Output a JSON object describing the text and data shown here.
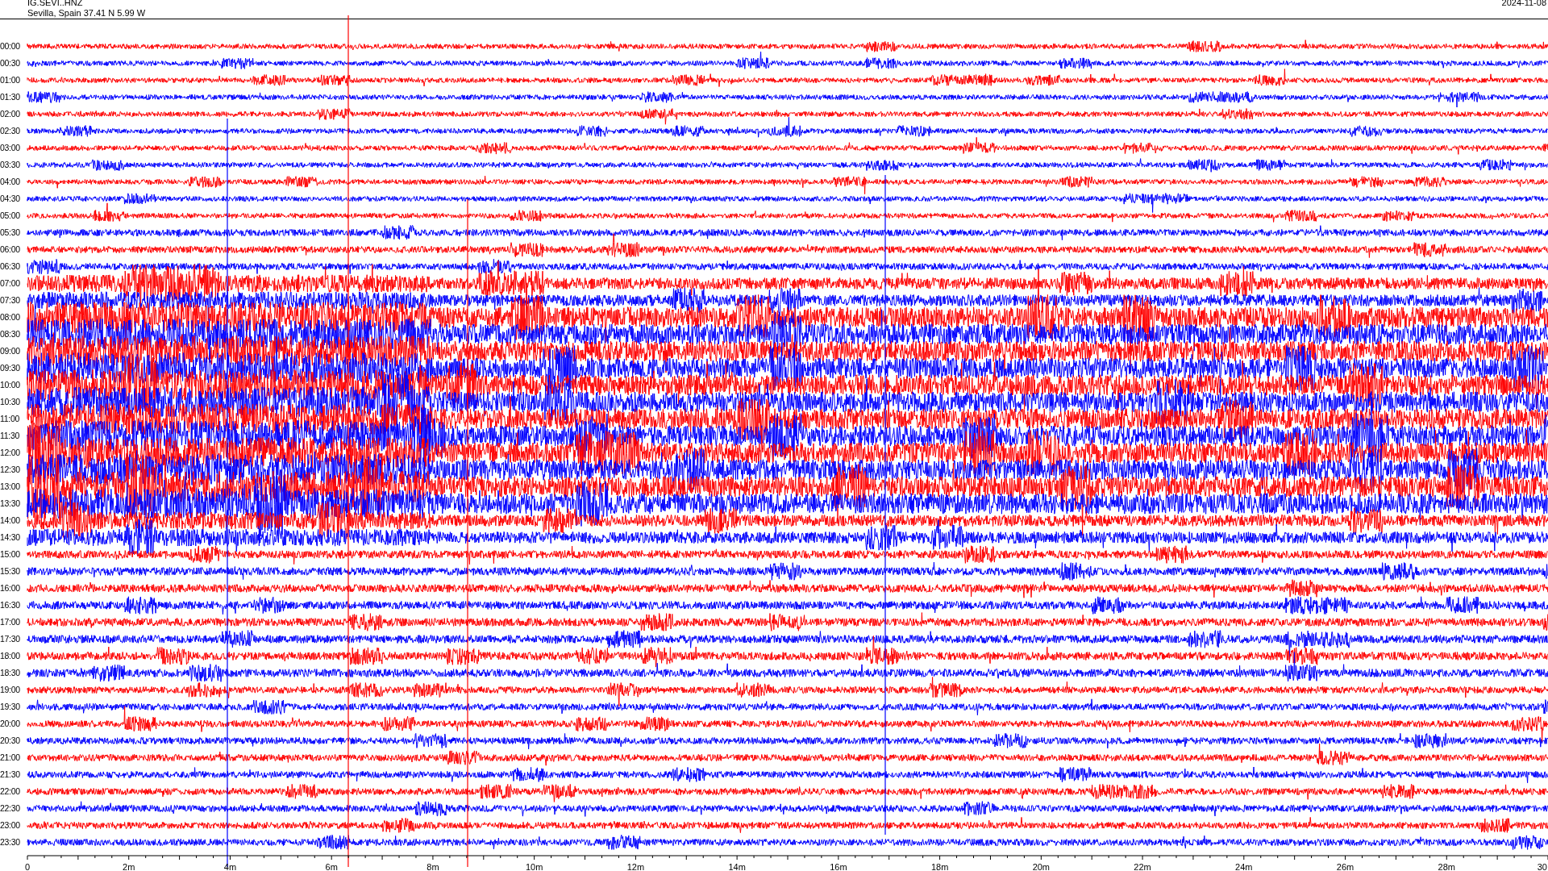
{
  "header": {
    "station": "IG.SEVI..HNZ",
    "location": "Sevilla, Spain  37.41 N 5.99 W",
    "date": "2024-11-08"
  },
  "rows": [
    {
      "label": "00:00",
      "color": "#ff0000"
    },
    {
      "label": "00:30",
      "color": "#0000ff"
    },
    {
      "label": "01:00",
      "color": "#ff0000"
    },
    {
      "label": "01:30",
      "color": "#0000ff"
    },
    {
      "label": "02:00",
      "color": "#ff0000"
    },
    {
      "label": "02:30",
      "color": "#0000ff"
    },
    {
      "label": "03:00",
      "color": "#ff0000"
    },
    {
      "label": "03:30",
      "color": "#0000ff"
    },
    {
      "label": "04:00",
      "color": "#ff0000"
    },
    {
      "label": "04:30",
      "color": "#0000ff"
    },
    {
      "label": "05:00",
      "color": "#ff0000"
    },
    {
      "label": "05:30",
      "color": "#0000ff"
    },
    {
      "label": "06:00",
      "color": "#ff0000"
    },
    {
      "label": "06:30",
      "color": "#0000ff"
    },
    {
      "label": "07:00",
      "color": "#ff0000"
    },
    {
      "label": "07:30",
      "color": "#0000ff"
    },
    {
      "label": "08:00",
      "color": "#ff0000"
    },
    {
      "label": "08:30",
      "color": "#0000ff"
    },
    {
      "label": "09:00",
      "color": "#ff0000"
    },
    {
      "label": "09:30",
      "color": "#0000ff"
    },
    {
      "label": "10:00",
      "color": "#ff0000"
    },
    {
      "label": "10:30",
      "color": "#0000ff"
    },
    {
      "label": "11:00",
      "color": "#ff0000"
    },
    {
      "label": "11:30",
      "color": "#0000ff"
    },
    {
      "label": "12:00",
      "color": "#ff0000"
    },
    {
      "label": "12:30",
      "color": "#0000ff"
    },
    {
      "label": "13:00",
      "color": "#ff0000"
    },
    {
      "label": "13:30",
      "color": "#0000ff"
    },
    {
      "label": "14:00",
      "color": "#ff0000"
    },
    {
      "label": "14:30",
      "color": "#0000ff"
    },
    {
      "label": "15:00",
      "color": "#ff0000"
    },
    {
      "label": "15:30",
      "color": "#0000ff"
    },
    {
      "label": "16:00",
      "color": "#ff0000"
    },
    {
      "label": "16:30",
      "color": "#0000ff"
    },
    {
      "label": "17:00",
      "color": "#ff0000"
    },
    {
      "label": "17:30",
      "color": "#0000ff"
    },
    {
      "label": "18:00",
      "color": "#ff0000"
    },
    {
      "label": "18:30",
      "color": "#0000ff"
    },
    {
      "label": "19:00",
      "color": "#ff0000"
    },
    {
      "label": "19:30",
      "color": "#0000ff"
    },
    {
      "label": "20:00",
      "color": "#ff0000"
    },
    {
      "label": "20:30",
      "color": "#0000ff"
    },
    {
      "label": "21:00",
      "color": "#ff0000"
    },
    {
      "label": "21:30",
      "color": "#0000ff"
    },
    {
      "label": "22:00",
      "color": "#ff0000"
    },
    {
      "label": "22:30",
      "color": "#0000ff"
    },
    {
      "label": "23:00",
      "color": "#ff0000"
    },
    {
      "label": "23:30",
      "color": "#0000ff"
    }
  ],
  "time_axis": {
    "ticks": [
      "0",
      "2m",
      "4m",
      "6m",
      "8m",
      "10m",
      "12m",
      "14m",
      "16m",
      "18m",
      "20m",
      "22m",
      "24m",
      "26m",
      "28m",
      "30"
    ]
  }
}
